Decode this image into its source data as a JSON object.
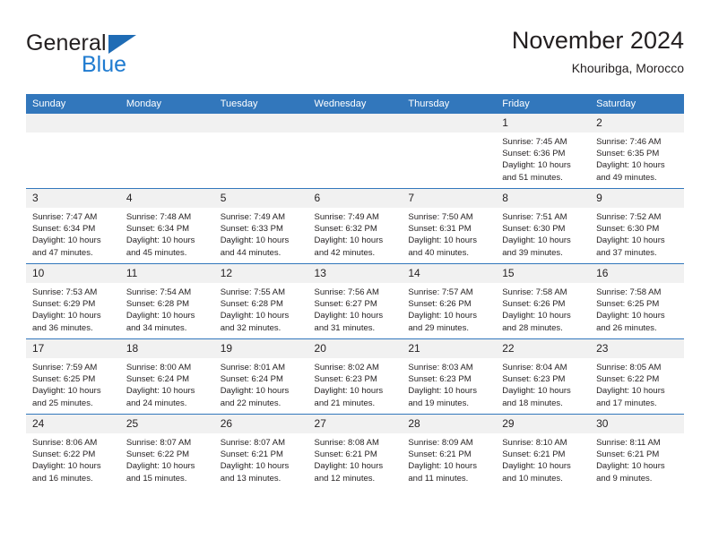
{
  "brand": {
    "name_dark": "General",
    "name_blue": "Blue",
    "accent_color": "#1f7bd0",
    "triangle_color": "#1f6cb5"
  },
  "header": {
    "title": "November 2024",
    "location": "Khouribga, Morocco",
    "header_bg": "#3277bc",
    "daynum_bg": "#f1f1f1"
  },
  "weekdays": [
    "Sunday",
    "Monday",
    "Tuesday",
    "Wednesday",
    "Thursday",
    "Friday",
    "Saturday"
  ],
  "weeks": [
    [
      {
        "day": "",
        "sunrise": "",
        "sunset": "",
        "daylight": "",
        "empty": true
      },
      {
        "day": "",
        "sunrise": "",
        "sunset": "",
        "daylight": "",
        "empty": true
      },
      {
        "day": "",
        "sunrise": "",
        "sunset": "",
        "daylight": "",
        "empty": true
      },
      {
        "day": "",
        "sunrise": "",
        "sunset": "",
        "daylight": "",
        "empty": true
      },
      {
        "day": "",
        "sunrise": "",
        "sunset": "",
        "daylight": "",
        "empty": true
      },
      {
        "day": "1",
        "sunrise": "Sunrise: 7:45 AM",
        "sunset": "Sunset: 6:36 PM",
        "daylight": "Daylight: 10 hours and 51 minutes."
      },
      {
        "day": "2",
        "sunrise": "Sunrise: 7:46 AM",
        "sunset": "Sunset: 6:35 PM",
        "daylight": "Daylight: 10 hours and 49 minutes."
      }
    ],
    [
      {
        "day": "3",
        "sunrise": "Sunrise: 7:47 AM",
        "sunset": "Sunset: 6:34 PM",
        "daylight": "Daylight: 10 hours and 47 minutes."
      },
      {
        "day": "4",
        "sunrise": "Sunrise: 7:48 AM",
        "sunset": "Sunset: 6:34 PM",
        "daylight": "Daylight: 10 hours and 45 minutes."
      },
      {
        "day": "5",
        "sunrise": "Sunrise: 7:49 AM",
        "sunset": "Sunset: 6:33 PM",
        "daylight": "Daylight: 10 hours and 44 minutes."
      },
      {
        "day": "6",
        "sunrise": "Sunrise: 7:49 AM",
        "sunset": "Sunset: 6:32 PM",
        "daylight": "Daylight: 10 hours and 42 minutes."
      },
      {
        "day": "7",
        "sunrise": "Sunrise: 7:50 AM",
        "sunset": "Sunset: 6:31 PM",
        "daylight": "Daylight: 10 hours and 40 minutes."
      },
      {
        "day": "8",
        "sunrise": "Sunrise: 7:51 AM",
        "sunset": "Sunset: 6:30 PM",
        "daylight": "Daylight: 10 hours and 39 minutes."
      },
      {
        "day": "9",
        "sunrise": "Sunrise: 7:52 AM",
        "sunset": "Sunset: 6:30 PM",
        "daylight": "Daylight: 10 hours and 37 minutes."
      }
    ],
    [
      {
        "day": "10",
        "sunrise": "Sunrise: 7:53 AM",
        "sunset": "Sunset: 6:29 PM",
        "daylight": "Daylight: 10 hours and 36 minutes."
      },
      {
        "day": "11",
        "sunrise": "Sunrise: 7:54 AM",
        "sunset": "Sunset: 6:28 PM",
        "daylight": "Daylight: 10 hours and 34 minutes."
      },
      {
        "day": "12",
        "sunrise": "Sunrise: 7:55 AM",
        "sunset": "Sunset: 6:28 PM",
        "daylight": "Daylight: 10 hours and 32 minutes."
      },
      {
        "day": "13",
        "sunrise": "Sunrise: 7:56 AM",
        "sunset": "Sunset: 6:27 PM",
        "daylight": "Daylight: 10 hours and 31 minutes."
      },
      {
        "day": "14",
        "sunrise": "Sunrise: 7:57 AM",
        "sunset": "Sunset: 6:26 PM",
        "daylight": "Daylight: 10 hours and 29 minutes."
      },
      {
        "day": "15",
        "sunrise": "Sunrise: 7:58 AM",
        "sunset": "Sunset: 6:26 PM",
        "daylight": "Daylight: 10 hours and 28 minutes."
      },
      {
        "day": "16",
        "sunrise": "Sunrise: 7:58 AM",
        "sunset": "Sunset: 6:25 PM",
        "daylight": "Daylight: 10 hours and 26 minutes."
      }
    ],
    [
      {
        "day": "17",
        "sunrise": "Sunrise: 7:59 AM",
        "sunset": "Sunset: 6:25 PM",
        "daylight": "Daylight: 10 hours and 25 minutes."
      },
      {
        "day": "18",
        "sunrise": "Sunrise: 8:00 AM",
        "sunset": "Sunset: 6:24 PM",
        "daylight": "Daylight: 10 hours and 24 minutes."
      },
      {
        "day": "19",
        "sunrise": "Sunrise: 8:01 AM",
        "sunset": "Sunset: 6:24 PM",
        "daylight": "Daylight: 10 hours and 22 minutes."
      },
      {
        "day": "20",
        "sunrise": "Sunrise: 8:02 AM",
        "sunset": "Sunset: 6:23 PM",
        "daylight": "Daylight: 10 hours and 21 minutes."
      },
      {
        "day": "21",
        "sunrise": "Sunrise: 8:03 AM",
        "sunset": "Sunset: 6:23 PM",
        "daylight": "Daylight: 10 hours and 19 minutes."
      },
      {
        "day": "22",
        "sunrise": "Sunrise: 8:04 AM",
        "sunset": "Sunset: 6:23 PM",
        "daylight": "Daylight: 10 hours and 18 minutes."
      },
      {
        "day": "23",
        "sunrise": "Sunrise: 8:05 AM",
        "sunset": "Sunset: 6:22 PM",
        "daylight": "Daylight: 10 hours and 17 minutes."
      }
    ],
    [
      {
        "day": "24",
        "sunrise": "Sunrise: 8:06 AM",
        "sunset": "Sunset: 6:22 PM",
        "daylight": "Daylight: 10 hours and 16 minutes."
      },
      {
        "day": "25",
        "sunrise": "Sunrise: 8:07 AM",
        "sunset": "Sunset: 6:22 PM",
        "daylight": "Daylight: 10 hours and 15 minutes."
      },
      {
        "day": "26",
        "sunrise": "Sunrise: 8:07 AM",
        "sunset": "Sunset: 6:21 PM",
        "daylight": "Daylight: 10 hours and 13 minutes."
      },
      {
        "day": "27",
        "sunrise": "Sunrise: 8:08 AM",
        "sunset": "Sunset: 6:21 PM",
        "daylight": "Daylight: 10 hours and 12 minutes."
      },
      {
        "day": "28",
        "sunrise": "Sunrise: 8:09 AM",
        "sunset": "Sunset: 6:21 PM",
        "daylight": "Daylight: 10 hours and 11 minutes."
      },
      {
        "day": "29",
        "sunrise": "Sunrise: 8:10 AM",
        "sunset": "Sunset: 6:21 PM",
        "daylight": "Daylight: 10 hours and 10 minutes."
      },
      {
        "day": "30",
        "sunrise": "Sunrise: 8:11 AM",
        "sunset": "Sunset: 6:21 PM",
        "daylight": "Daylight: 10 hours and 9 minutes."
      }
    ]
  ]
}
